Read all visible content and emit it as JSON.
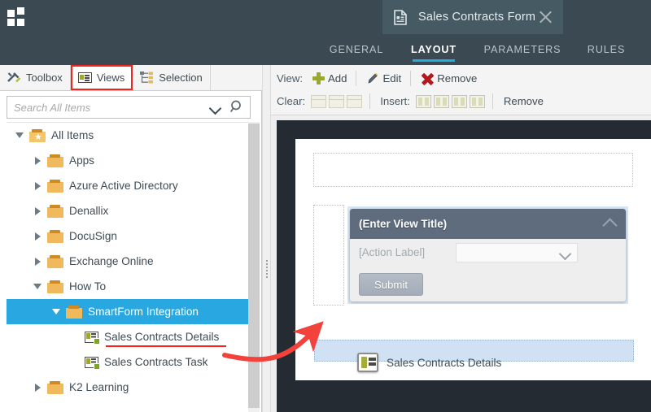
{
  "header": {
    "logo_icon": "grid-logo-icon",
    "document_tab": {
      "icon": "form-document-icon",
      "title": "Sales Contracts Form",
      "close_icon": "close-icon"
    },
    "ribbon_tabs": [
      {
        "label": "GENERAL",
        "active": false
      },
      {
        "label": "LAYOUT",
        "active": true
      },
      {
        "label": "PARAMETERS",
        "active": false
      },
      {
        "label": "RULES",
        "active": false
      }
    ],
    "accent_color": "#27a9e1",
    "background_color": "#3b4a52"
  },
  "left_panel": {
    "tabs": [
      {
        "label": "Toolbox",
        "icon": "toolbox-icon",
        "highlighted": false
      },
      {
        "label": "Views",
        "icon": "views-icon",
        "highlighted": true
      },
      {
        "label": "Selection",
        "icon": "selection-tree-icon",
        "highlighted": false
      }
    ],
    "highlight_color": "#f3241e",
    "search": {
      "placeholder": "Search All Items",
      "value": "",
      "dropdown_icon": "chevron-down-icon",
      "search_icon": "search-icon"
    },
    "tree": [
      {
        "label": "All Items",
        "icon": "folder-star-icon",
        "indent": 0,
        "state": "expanded",
        "selected": false
      },
      {
        "label": "Apps",
        "icon": "folder-icon",
        "indent": 1,
        "state": "collapsed",
        "selected": false
      },
      {
        "label": "Azure Active Directory",
        "icon": "folder-icon",
        "indent": 1,
        "state": "collapsed",
        "selected": false
      },
      {
        "label": "Denallix",
        "icon": "folder-icon",
        "indent": 1,
        "state": "collapsed",
        "selected": false
      },
      {
        "label": "DocuSign",
        "icon": "folder-icon",
        "indent": 1,
        "state": "collapsed",
        "selected": false
      },
      {
        "label": "Exchange Online",
        "icon": "folder-icon",
        "indent": 1,
        "state": "collapsed",
        "selected": false
      },
      {
        "label": "How To",
        "icon": "folder-icon",
        "indent": 1,
        "state": "expanded",
        "selected": false
      },
      {
        "label": "SmartForm Integration",
        "icon": "folder-icon",
        "indent": 2,
        "state": "expanded",
        "selected": true
      },
      {
        "label": "Sales Contracts Details",
        "icon": "view-item-icon",
        "indent": 3,
        "state": "leaf",
        "selected": false,
        "underlined": true
      },
      {
        "label": "Sales Contracts Task",
        "icon": "view-item-icon",
        "indent": 3,
        "state": "leaf",
        "selected": false
      },
      {
        "label": "K2 Learning",
        "icon": "folder-icon",
        "indent": 1,
        "state": "collapsed",
        "selected": false
      }
    ],
    "selection_color": "#29a7e1"
  },
  "toolbar": {
    "row1": {
      "label": "View:",
      "buttons": [
        {
          "label": "Add",
          "icon": "plus-icon"
        },
        {
          "label": "Edit",
          "icon": "pencil-icon"
        },
        {
          "label": "Remove",
          "icon": "red-x-icon"
        }
      ]
    },
    "row2": {
      "clear_label": "Clear:",
      "clear_icons": [
        "clear-row-icon",
        "clear-column-icon",
        "clear-table-icon"
      ],
      "insert_label": "Insert:",
      "insert_icons": [
        "insert-column-left-icon",
        "insert-column-right-icon",
        "insert-row-above-icon",
        "insert-row-below-icon"
      ],
      "remove_label": "Remove"
    }
  },
  "canvas": {
    "background_color": "#252b33",
    "view_panel": {
      "title": "(Enter View Title)",
      "collapse_icon": "chevron-up-icon",
      "action_label": "[Action Label]",
      "dropdown_value": "",
      "dropdown_icon": "chevron-down-icon",
      "submit_label": "Submit"
    },
    "drop_zone": {
      "highlight_color": "#cfe1f2"
    },
    "drag_ghost": {
      "label": "Sales Contracts Details",
      "icon": "view-item-icon"
    },
    "annotation": {
      "arrow_color": "#f3413c",
      "type": "curved-arrow"
    }
  }
}
